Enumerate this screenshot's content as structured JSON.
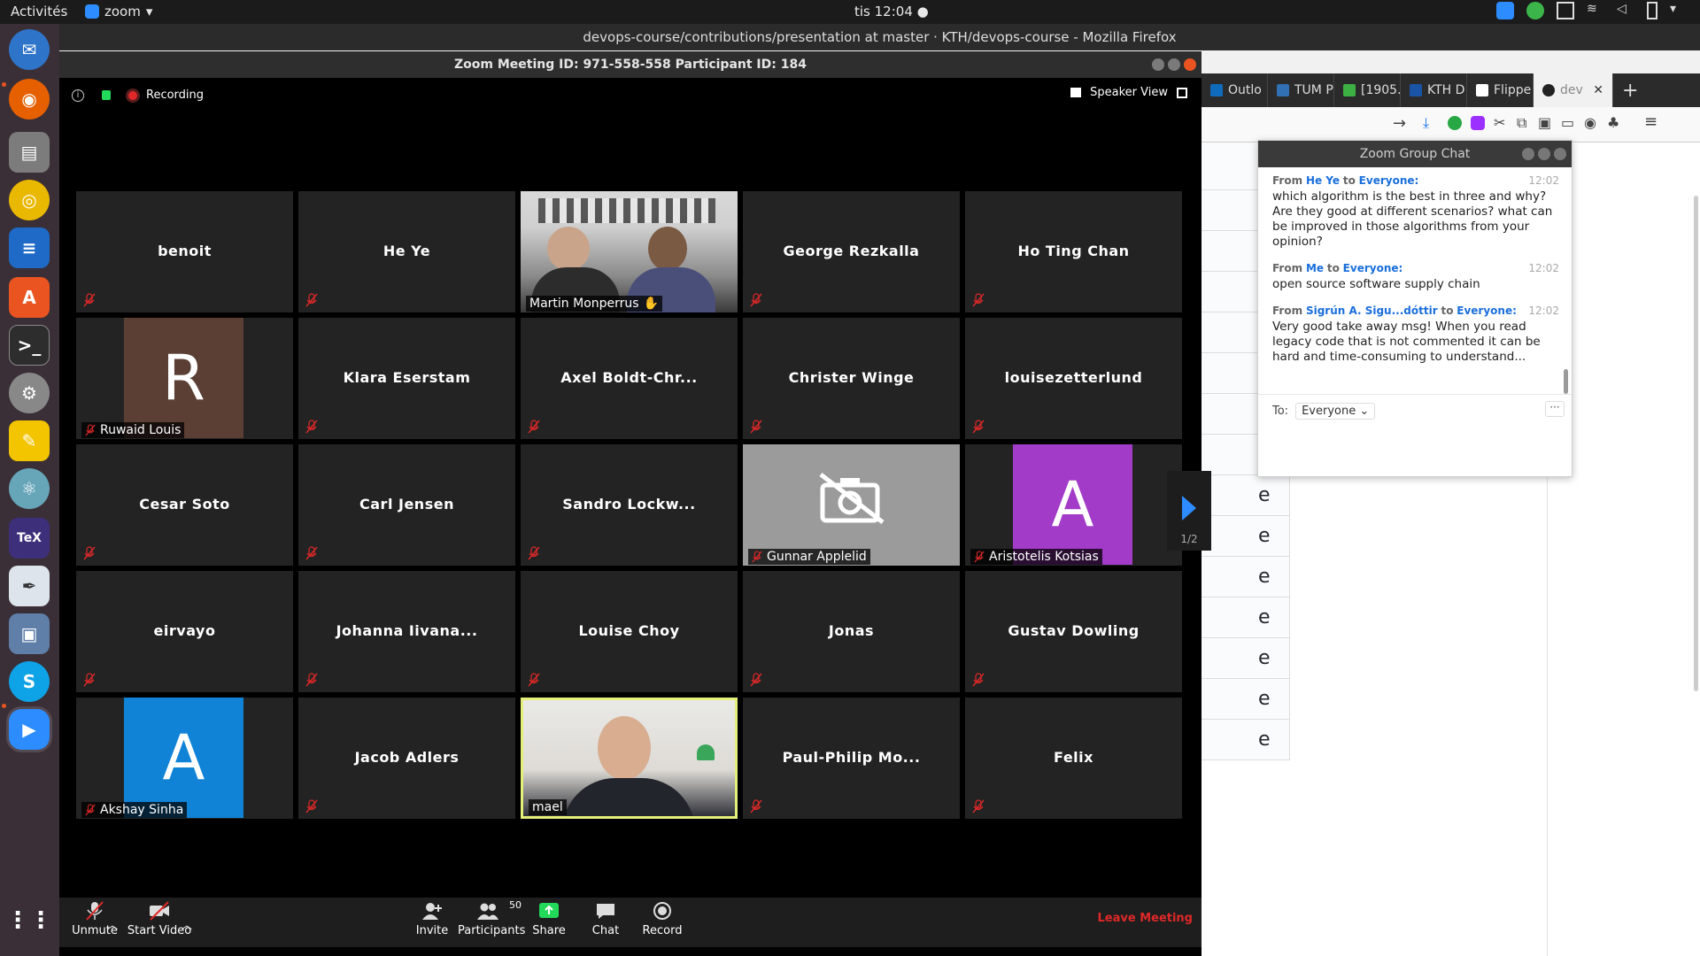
{
  "topbar": {
    "activities": "Activités",
    "app_menu": "zoom",
    "clock": "tis 12:04"
  },
  "firefox": {
    "title": "devops-course/contributions/presentation at master · KTH/devops-course - Mozilla Firefox",
    "tabs": [
      {
        "label": "Outlo",
        "color": "#0f6cbd"
      },
      {
        "label": "TUM P",
        "color": "#3070b3"
      },
      {
        "label": "[1905.",
        "color": "#3cb043"
      },
      {
        "label": "KTH D",
        "color": "#1954a6"
      },
      {
        "label": "Flippe",
        "color": "#ffffff"
      },
      {
        "label": "dev",
        "color": "#222222"
      }
    ],
    "page_letter": "e"
  },
  "zoom": {
    "title": "Zoom Meeting ID: 971-558-558 Participant ID: 184",
    "recording_label": "Recording",
    "speaker_view_label": "Speaker View",
    "page_indicator": "1/2",
    "participants": [
      {
        "name": "benoit",
        "type": "name"
      },
      {
        "name": "He Ye",
        "type": "name"
      },
      {
        "name": "Martin Monperrus",
        "type": "video"
      },
      {
        "name": "George Rezkalla",
        "type": "name"
      },
      {
        "name": "Ho Ting Chan",
        "type": "name"
      },
      {
        "name": "Ruwaid Louis",
        "type": "avatar",
        "letter": "R",
        "color": "#5b3f35"
      },
      {
        "name": "Klara Eserstam",
        "type": "name"
      },
      {
        "name": "Axel Boldt-Chr...",
        "type": "name"
      },
      {
        "name": "Christer Winge",
        "type": "name"
      },
      {
        "name": "louisezetterlund",
        "type": "name"
      },
      {
        "name": "Cesar Soto",
        "type": "name"
      },
      {
        "name": "Carl Jensen",
        "type": "name"
      },
      {
        "name": "Sandro Lockw...",
        "type": "name"
      },
      {
        "name": "Gunnar Applelid",
        "type": "novideo"
      },
      {
        "name": "Aristotelis Kotsias",
        "type": "avatar",
        "letter": "A",
        "color": "#a23bc7"
      },
      {
        "name": "eirvayo",
        "type": "name"
      },
      {
        "name": "Johanna Iivana...",
        "type": "name"
      },
      {
        "name": "Louise Choy",
        "type": "name"
      },
      {
        "name": "Jonas",
        "type": "name"
      },
      {
        "name": "Gustav Dowling",
        "type": "name"
      },
      {
        "name": "Akshay Sinha",
        "type": "avatar",
        "letter": "A",
        "color": "#1083d6"
      },
      {
        "name": "Jacob Adlers",
        "type": "name"
      },
      {
        "name": "mael",
        "type": "video-active"
      },
      {
        "name": "Paul-Philip Mo...",
        "type": "name"
      },
      {
        "name": "Felix",
        "type": "name"
      }
    ],
    "toolbar": {
      "unmute": "Unmute",
      "start_video": "Start Video",
      "invite": "Invite",
      "participants": "Participants",
      "participants_count": "50",
      "share": "Share",
      "chat": "Chat",
      "record": "Record",
      "leave": "Leave Meeting"
    }
  },
  "chat": {
    "title": "Zoom Group Chat",
    "messages": [
      {
        "from_label": "From",
        "sender": "He Ye",
        "to_label": "to",
        "recipient": "Everyone:",
        "time": "12:02",
        "text": "which algorithm is the best in three and why? Are they good at different scenarios? what can be improved in those algorithms from your opinion?"
      },
      {
        "from_label": "From",
        "sender": "Me",
        "to_label": "to",
        "recipient": "Everyone:",
        "time": "12:02",
        "text": "open source software supply chain"
      },
      {
        "from_label": "From",
        "sender": "Sigrún A. Sigu...dóttir",
        "to_label": "to",
        "recipient": "Everyone:",
        "time": "12:02",
        "text": "Very good take away msg! When you read legacy code that is not commented it can be hard and time-consuming to understand..."
      }
    ],
    "to_label": "To:",
    "to_value": "Everyone",
    "more_label": "···"
  }
}
